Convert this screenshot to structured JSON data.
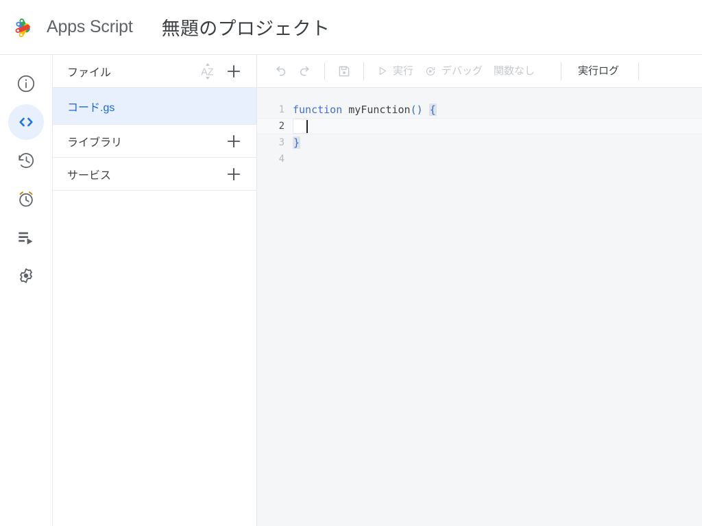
{
  "header": {
    "logo_icon": "apps-script-logo",
    "brand": "Apps Script",
    "project_title": "無題のプロジェクト",
    "brand_colors": {
      "blue": "#4285F4",
      "green": "#34A853",
      "yellow": "#FBBC04",
      "red": "#EA4335"
    }
  },
  "rail": {
    "items": [
      {
        "id": "overview",
        "icon": "info-circle-icon",
        "active": false
      },
      {
        "id": "editor",
        "icon": "code-brackets-icon",
        "active": true
      },
      {
        "id": "history",
        "icon": "clock-history-icon",
        "active": false
      },
      {
        "id": "triggers",
        "icon": "alarm-clock-icon",
        "active": false
      },
      {
        "id": "executions",
        "icon": "executions-list-play-icon",
        "active": false
      },
      {
        "id": "settings",
        "icon": "gear-icon",
        "active": false
      }
    ],
    "active_color": "#1a73e8",
    "active_bg": "#e8f0fe"
  },
  "files_panel": {
    "files_header": {
      "label": "ファイル",
      "sort_icon": "sort-az-icon",
      "add_icon": "plus-icon"
    },
    "files": [
      {
        "name": "コード.gs",
        "selected": true
      }
    ],
    "libraries_header": {
      "label": "ライブラリ",
      "add_icon": "plus-icon"
    },
    "services_header": {
      "label": "サービス",
      "add_icon": "plus-icon"
    },
    "selected_bg": "#e8f0fe",
    "selected_text": "#1967d2"
  },
  "toolbar": {
    "undo": {
      "label": "元に戻す",
      "icon": "undo-icon",
      "disabled": true
    },
    "redo": {
      "label": "やり直し",
      "icon": "redo-icon",
      "disabled": true
    },
    "save": {
      "label": "保存",
      "icon": "save-floppy-icon",
      "disabled": true
    },
    "run": {
      "label": "実行",
      "icon": "play-triangle-icon",
      "disabled": true
    },
    "debug": {
      "label": "デバッグ",
      "icon": "debug-icon",
      "disabled": true
    },
    "function_select": {
      "label": "関数なし",
      "disabled": true
    },
    "run_log": {
      "label": "実行ログ",
      "disabled": false
    }
  },
  "editor": {
    "lines": [
      {
        "number": "1",
        "active": false,
        "tokens": [
          {
            "text": "function",
            "type": "kw"
          },
          {
            "text": " ",
            "type": "plain"
          },
          {
            "text": "myFunction",
            "type": "fn"
          },
          {
            "text": "()",
            "type": "par"
          },
          {
            "text": " ",
            "type": "plain"
          },
          {
            "text": "{",
            "type": "brace-match"
          }
        ]
      },
      {
        "number": "2",
        "active": true,
        "tokens": []
      },
      {
        "number": "3",
        "active": false,
        "tokens": [
          {
            "text": "}",
            "type": "brace-match"
          }
        ]
      },
      {
        "number": "4",
        "active": false,
        "tokens": []
      }
    ],
    "cursor_line": "2",
    "background": "#f5f6f8",
    "active_line_bg": "#f8f9fb"
  }
}
